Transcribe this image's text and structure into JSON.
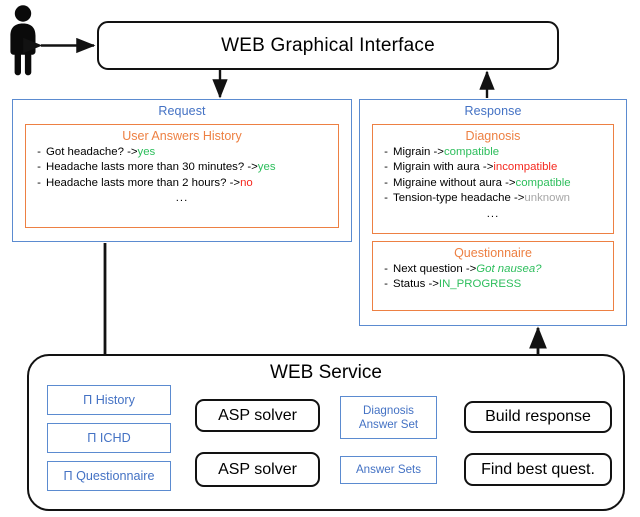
{
  "actor": {
    "name": "user-person"
  },
  "gui": {
    "title": "WEB Graphical Interface"
  },
  "request": {
    "title": "Request",
    "history": {
      "title": "User Answers History",
      "items": [
        {
          "dash": "-",
          "question": "Got headache? -> ",
          "answer": "yes",
          "answer_color": "green"
        },
        {
          "dash": "-",
          "question": "Headache lasts more than 30 minutes? -> ",
          "answer": "yes",
          "answer_color": "green"
        },
        {
          "dash": "-",
          "question": "Headache lasts more than 2 hours? -> ",
          "answer": "no",
          "answer_color": "red"
        }
      ],
      "ellipsis": "..."
    }
  },
  "response": {
    "title": "Response",
    "diagnosis": {
      "title": "Diagnosis",
      "items": [
        {
          "dash": "-",
          "question": "Migrain -> ",
          "answer": "compatible",
          "answer_color": "green"
        },
        {
          "dash": "-",
          "question": "Migrain with aura  -> ",
          "answer": "incompatible",
          "answer_color": "red"
        },
        {
          "dash": "-",
          "question": "Migraine without aura -> ",
          "answer": "compatible",
          "answer_color": "green"
        },
        {
          "dash": "-",
          "question": "Tension-type headache -> ",
          "answer": "unknown",
          "answer_color": "gray"
        }
      ],
      "ellipsis": "..."
    },
    "questionnaire": {
      "title": "Questionnaire",
      "items": [
        {
          "dash": "-",
          "question": "Next question -> ",
          "answer": "Got nausea?",
          "answer_color": "green-italic"
        },
        {
          "dash": "-",
          "question": "Status -> ",
          "answer": "IN_PROGRESS",
          "answer_color": "green"
        }
      ]
    }
  },
  "service": {
    "title": "WEB Service",
    "inputs": [
      {
        "label": "Π History"
      },
      {
        "label": "Π ICHD"
      },
      {
        "label": "Π Questionnaire"
      }
    ],
    "solvers": [
      {
        "label": "ASP solver"
      },
      {
        "label": "ASP solver"
      }
    ],
    "answer_sets": [
      {
        "line1": "Diagnosis",
        "line2": "Answer Set"
      },
      {
        "line1": "Answer Sets",
        "line2": ""
      }
    ],
    "outputs": [
      {
        "label": "Build response"
      },
      {
        "label": "Find best quest."
      }
    ]
  },
  "colors": {
    "blue": "#4472C4",
    "blue_border": "#5B8BD0",
    "orange": "#ED8043",
    "green": "#2DBE5C",
    "red": "#F5281E",
    "gray": "#A6A6A6",
    "black": "#121212"
  }
}
